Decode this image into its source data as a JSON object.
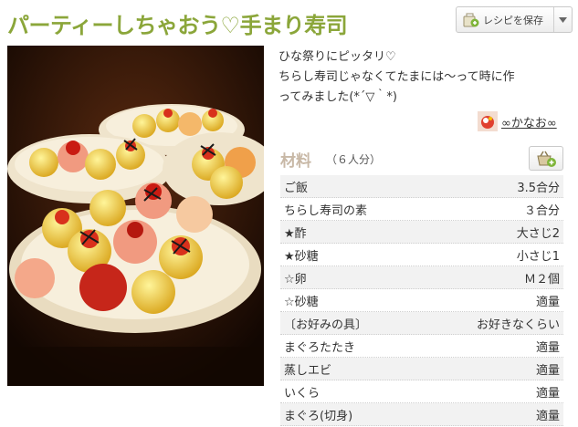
{
  "recipe": {
    "title": "パーティーしちゃおう♡手まり寿司",
    "save_label": "レシピを保存",
    "description": [
      "ひな祭りにピッタリ♡",
      "ちらし寿司じゃなくてたまには〜って時に作",
      "ってみました(*´▽｀*)"
    ],
    "author": "∞かなお∞"
  },
  "ingredients": {
    "title": "材料",
    "servings": "（６人分）",
    "items": [
      {
        "name": "ご飯",
        "qty": "3.5合分"
      },
      {
        "name": "ちらし寿司の素",
        "qty": "３合分"
      },
      {
        "name": "★酢",
        "qty": "大さじ2"
      },
      {
        "name": "★砂糖",
        "qty": "小さじ1"
      },
      {
        "name": "☆卵",
        "qty": "Ｍ２個"
      },
      {
        "name": "☆砂糖",
        "qty": "適量"
      },
      {
        "name": "〔お好みの具〕",
        "qty": "お好きなくらい"
      },
      {
        "name": "まぐろたたき",
        "qty": "適量"
      },
      {
        "name": "蒸しエビ",
        "qty": "適量"
      },
      {
        "name": "いくら",
        "qty": "適量"
      },
      {
        "name": "まぐろ(切身)",
        "qty": "適量"
      }
    ]
  },
  "icons": {
    "save": "save-recipe-icon",
    "dropdown": "chevron-down-icon",
    "basket": "shopping-basket-add-icon",
    "avatar": "author-avatar"
  },
  "colors": {
    "title": "#8ba63a",
    "ingredients_title": "#c8b8a6",
    "row_alt": "#f2f2f2"
  }
}
